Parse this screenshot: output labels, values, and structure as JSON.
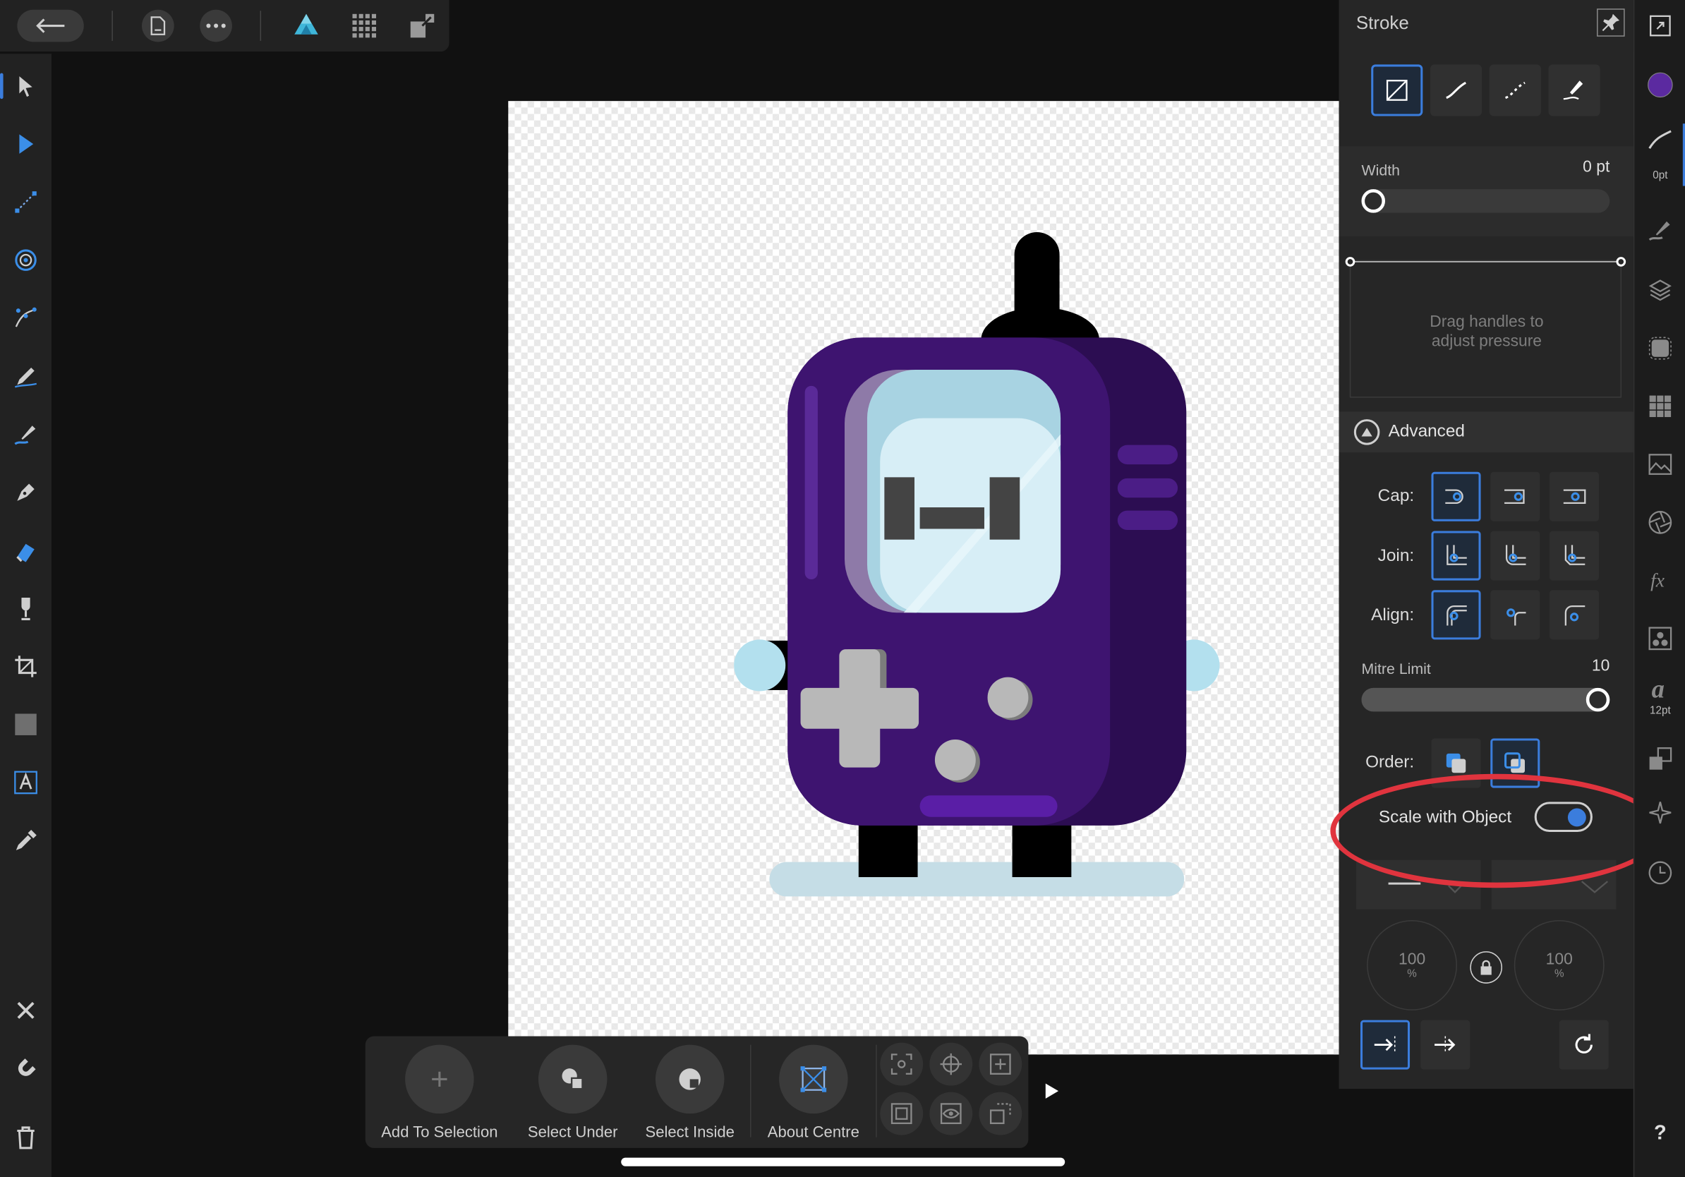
{
  "panel": {
    "title": "Stroke",
    "width_label": "Width",
    "width_value": "0 pt",
    "width_fraction": 0.0,
    "pressure_hint": "Drag handles to\nadjust pressure",
    "advanced_label": "Advanced",
    "cap_label": "Cap:",
    "join_label": "Join:",
    "align_label": "Align:",
    "mitre_label": "Mitre Limit",
    "mitre_value": "10",
    "mitre_fraction": 1.0,
    "order_label": "Order:",
    "scale_label": "Scale with Object",
    "scale_on": true,
    "start_scale": "100",
    "end_scale": "100",
    "percent": "%"
  },
  "strip": {
    "color": "#5b2aa0",
    "brush_size": "0pt",
    "font_size": "12pt",
    "help": "?"
  },
  "context": {
    "add_to_selection": "Add To Selection",
    "select_under": "Select Under",
    "select_inside": "Select Inside",
    "about_centre": "About Centre"
  },
  "colors": {
    "accent": "#3b7ddd",
    "highlight": "#e0343e",
    "device_body": "#3e1470",
    "device_dark": "#2c0d52",
    "screen": "#d7eef6"
  }
}
